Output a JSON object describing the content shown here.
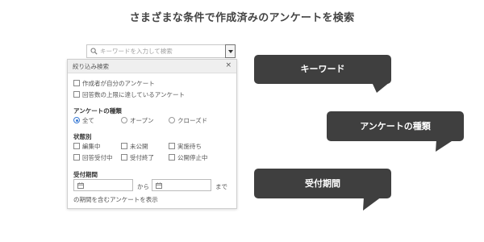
{
  "heading": "さまざまな条件で作成済みのアンケートを検索",
  "search": {
    "placeholder": "キーワードを入力して検索",
    "icon": "search-icon",
    "dropdown_icon": "caret-down-icon"
  },
  "panel": {
    "title": "絞り込み検索",
    "close_label": "×",
    "flags": [
      {
        "label": "作成者が自分のアンケート",
        "checked": false
      },
      {
        "label": "回答数の上限に達しているアンケート",
        "checked": false
      }
    ],
    "type_section": {
      "title": "アンケートの種類",
      "options": [
        {
          "label": "全て",
          "selected": true
        },
        {
          "label": "オープン",
          "selected": false
        },
        {
          "label": "クローズド",
          "selected": false
        }
      ]
    },
    "status_section": {
      "title": "状態別",
      "options": [
        {
          "label": "編集中",
          "checked": false
        },
        {
          "label": "未公開",
          "checked": false
        },
        {
          "label": "実施待ち",
          "checked": false
        },
        {
          "label": "回答受付中",
          "checked": false
        },
        {
          "label": "受付終了",
          "checked": false
        },
        {
          "label": "公開停止中",
          "checked": false
        }
      ]
    },
    "period_section": {
      "title": "受付期間",
      "from_label": "から",
      "to_label": "まで",
      "note": "の期間を含むアンケートを表示",
      "calendar_icon": "calendar-icon"
    }
  },
  "callouts": {
    "keyword": "キーワード",
    "type": "アンケートの種類",
    "period": "受付期間"
  },
  "colors": {
    "callout_bg": "#3f3f3f",
    "radio_selected": "#3a7bd5"
  }
}
